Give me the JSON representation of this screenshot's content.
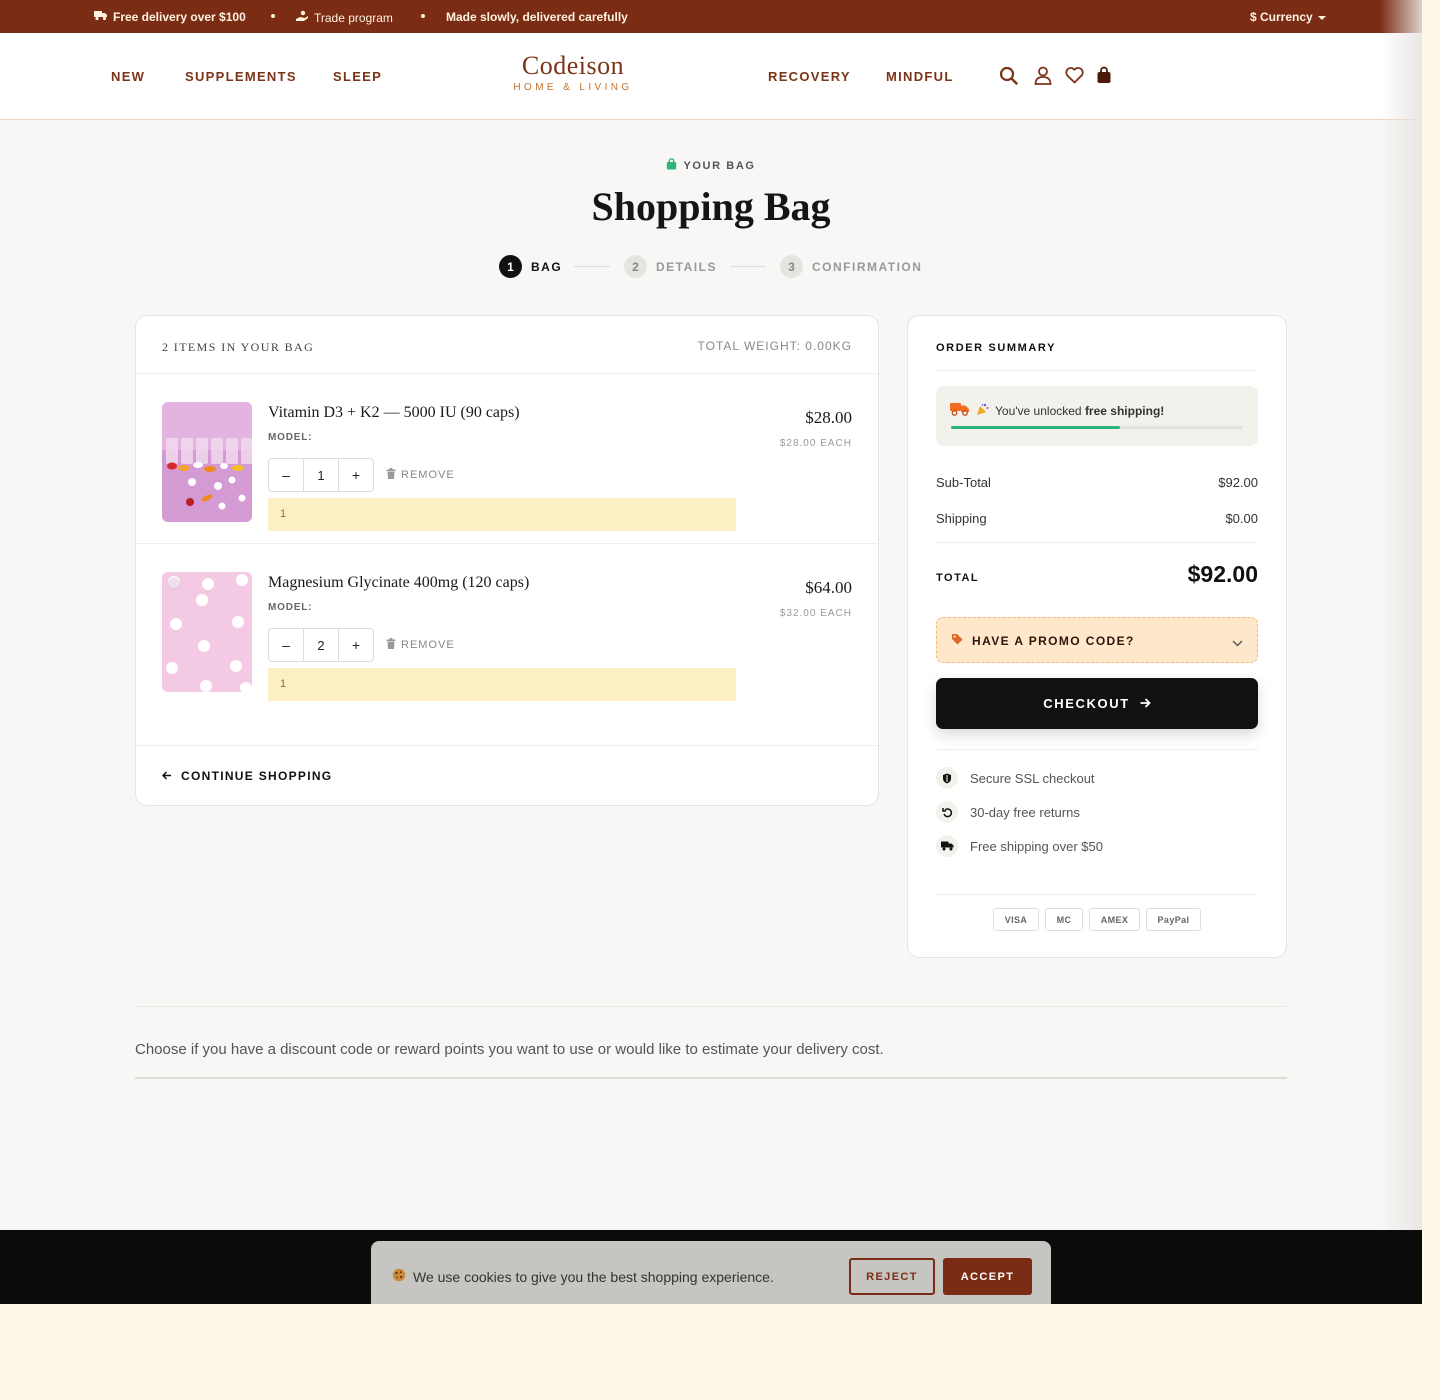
{
  "topbar": {
    "delivery": "Free delivery over $100",
    "trade": "Trade program",
    "made": "Made slowly, delivered carefully",
    "currency": "$ Currency"
  },
  "header": {
    "nav_left": [
      "NEW",
      "SUPPLEMENTS",
      "SLEEP"
    ],
    "nav_right": [
      "RECOVERY",
      "MINDFUL"
    ],
    "logo_name": "Codeison",
    "logo_sub": "HOME & LIVING",
    "icons": [
      "search-icon",
      "account-icon",
      "wishlist-icon",
      "bag-icon"
    ]
  },
  "page": {
    "eyebrow": "YOUR BAG",
    "title": "Shopping Bag",
    "steps": [
      {
        "num": "1",
        "label": "BAG"
      },
      {
        "num": "2",
        "label": "DETAILS"
      },
      {
        "num": "3",
        "label": "CONFIRMATION"
      }
    ]
  },
  "cart": {
    "count": "2 ITEMS IN YOUR BAG",
    "weight": "TOTAL WEIGHT: 0.00KG",
    "model_label": "MODEL:",
    "remove_label": "REMOVE",
    "items": [
      {
        "name": "Vitamin D3 + K2 — 5000 IU (90 caps)",
        "qty": "1",
        "price": "$28.00",
        "each": "$28.00 EACH",
        "note": "1"
      },
      {
        "name": "Magnesium Glycinate 400mg (120 caps)",
        "qty": "2",
        "price": "$64.00",
        "each": "$32.00 EACH",
        "note": "1"
      }
    ],
    "continue": "CONTINUE SHOPPING"
  },
  "summary": {
    "title": "ORDER SUMMARY",
    "ship_prefix": "You've unlocked",
    "ship_bold": "free shipping!",
    "ship_progress": 0.58,
    "subtotal_label": "Sub-Total",
    "subtotal": "$92.00",
    "shipping_label": "Shipping",
    "shipping": "$0.00",
    "total_label": "TOTAL",
    "total": "$92.00",
    "promo": "HAVE A PROMO CODE?",
    "checkout": "CHECKOUT",
    "trust": [
      "Secure SSL checkout",
      "30-day free returns",
      "Free shipping over $50"
    ],
    "payments": [
      "VISA",
      "MC",
      "AMEX",
      "PayPal"
    ]
  },
  "explain": "Choose if you have a discount code or reward points you want to use or would like to estimate your delivery cost.",
  "cookie": {
    "message": "We use cookies to give you the best shopping experience.",
    "reject": "REJECT",
    "accept": "ACCEPT"
  },
  "colors": {
    "brand": "#7b2c14",
    "accent_green": "#2bb57a",
    "promo_bg": "#ffe7cc",
    "note_bg": "#fdefc4"
  }
}
